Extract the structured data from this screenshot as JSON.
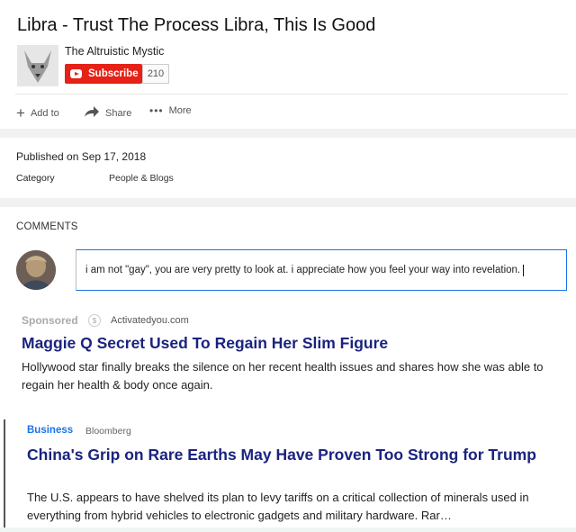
{
  "video": {
    "title": "Libra - Trust The Process Libra, This Is Good"
  },
  "channel": {
    "name": "The Altruistic Mystic",
    "subscribe_label": "Subscribe",
    "subscriber_count": "210"
  },
  "actions": {
    "add_to": "Add to",
    "share": "Share",
    "more": "More"
  },
  "details": {
    "published": "Published on Sep 17, 2018",
    "category_label": "Category",
    "category_value": "People & Blogs"
  },
  "comments": {
    "heading": "COMMENTS",
    "draft_text": "i am not \"gay\", you are very pretty to look at. i appreciate how you feel your way into revelation."
  },
  "sponsored": {
    "label": "Sponsored",
    "source": "Activatedyou.com",
    "headline": "Maggie Q Secret Used To Regain Her Slim Figure",
    "description": "Hollywood star finally breaks the silence on her recent health issues and shares how she was able to regain her health & body once again."
  },
  "news": {
    "category": "Business",
    "source": "Bloomberg",
    "headline": "China's Grip on Rare Earths May Have Proven Too Strong for Trump",
    "description": "The U.S. appears to have shelved its plan to levy tariffs on a critical collection of minerals used in everything from hybrid vehicles to electronic gadgets and military hardware. Rar…"
  },
  "colors": {
    "subscribe": "#e62117",
    "headline": "#1a237e",
    "news_category": "#1a73e8",
    "focus_border": "#1a73e8"
  }
}
